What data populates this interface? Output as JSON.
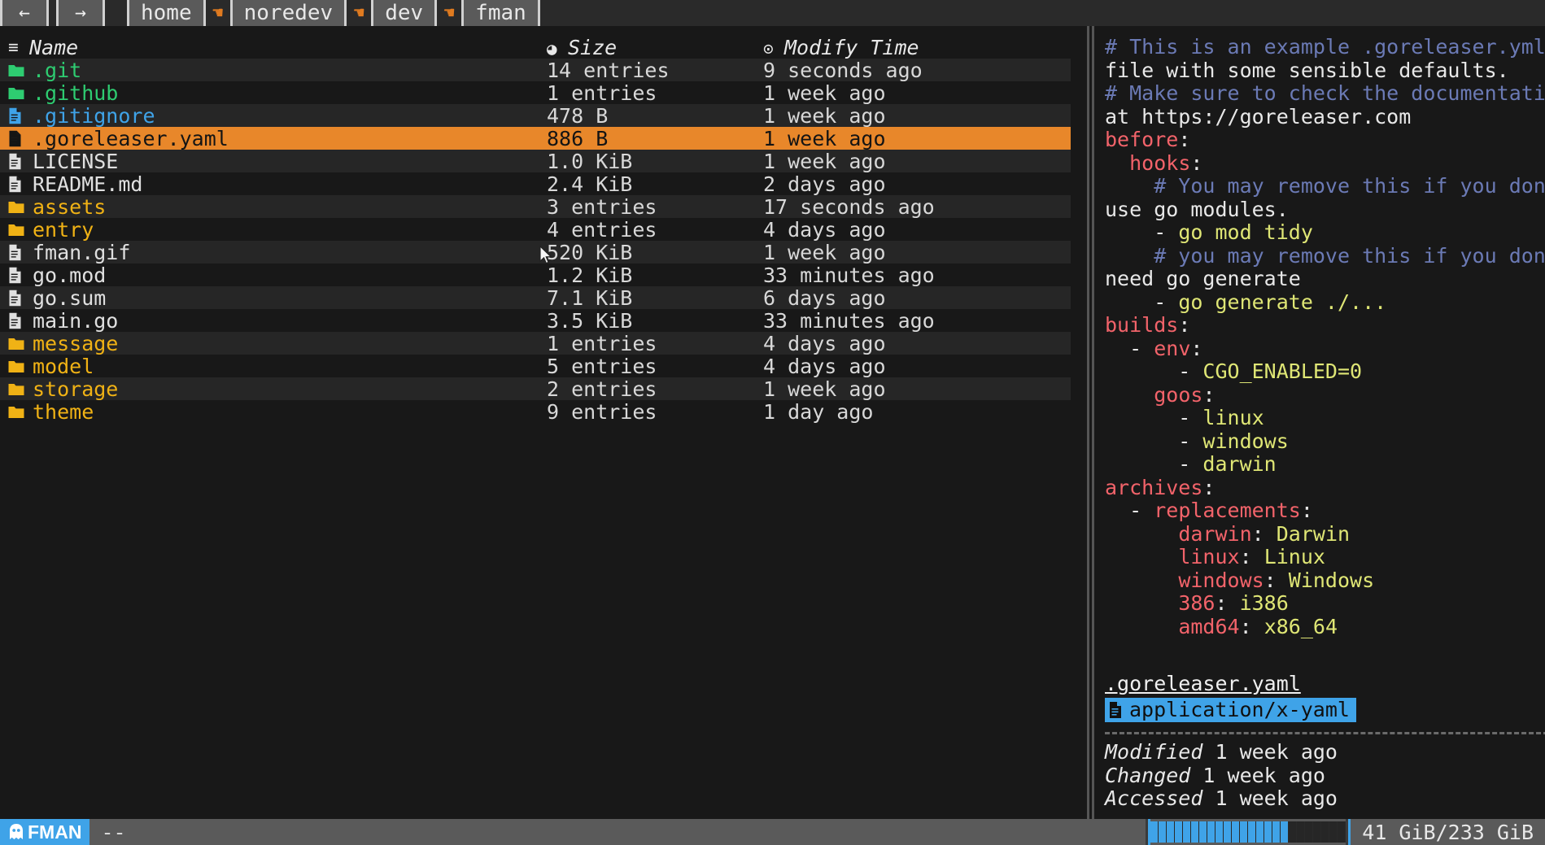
{
  "navbar": {
    "back_label": "←",
    "forward_label": "→",
    "separator_icon": "☚",
    "crumbs": [
      "home",
      "noredev",
      "dev",
      "fman"
    ]
  },
  "filelist": {
    "headers": {
      "name": "Name",
      "size": "Size",
      "time": "Modify Time",
      "name_icon": "≡",
      "size_icon": "◕",
      "time_icon": "⊙"
    },
    "rows": [
      {
        "name": ".git",
        "type": "folder",
        "color": "green",
        "size": "14 entries",
        "time": "9 seconds ago",
        "selected": false
      },
      {
        "name": ".github",
        "type": "folder",
        "color": "green",
        "size": "1 entries",
        "time": "1 week ago",
        "selected": false
      },
      {
        "name": ".gitignore",
        "type": "file",
        "color": "blue",
        "size": "478 B",
        "time": "1 week ago",
        "selected": false
      },
      {
        "name": ".goreleaser.yaml",
        "type": "file",
        "color": "dark",
        "size": "886 B",
        "time": "1 week ago",
        "selected": true
      },
      {
        "name": "LICENSE",
        "type": "file",
        "color": "white",
        "size": "1.0 KiB",
        "time": "1 week ago",
        "selected": false
      },
      {
        "name": "README.md",
        "type": "file",
        "color": "white",
        "size": "2.4 KiB",
        "time": "2 days ago",
        "selected": false
      },
      {
        "name": "assets",
        "type": "folder",
        "color": "yellow",
        "size": "3 entries",
        "time": "17 seconds ago",
        "selected": false
      },
      {
        "name": "entry",
        "type": "folder",
        "color": "yellow",
        "size": "4 entries",
        "time": "4 days ago",
        "selected": false
      },
      {
        "name": "fman.gif",
        "type": "file",
        "color": "white",
        "size": "520 KiB",
        "time": "1 week ago",
        "selected": false
      },
      {
        "name": "go.mod",
        "type": "file",
        "color": "white",
        "size": "1.2 KiB",
        "time": "33 minutes ago",
        "selected": false
      },
      {
        "name": "go.sum",
        "type": "file",
        "color": "white",
        "size": "7.1 KiB",
        "time": "6 days ago",
        "selected": false
      },
      {
        "name": "main.go",
        "type": "file",
        "color": "white",
        "size": "3.5 KiB",
        "time": "33 minutes ago",
        "selected": false
      },
      {
        "name": "message",
        "type": "folder",
        "color": "yellow",
        "size": "1 entries",
        "time": "4 days ago",
        "selected": false
      },
      {
        "name": "model",
        "type": "folder",
        "color": "yellow",
        "size": "5 entries",
        "time": "4 days ago",
        "selected": false
      },
      {
        "name": "storage",
        "type": "folder",
        "color": "yellow",
        "size": "2 entries",
        "time": "1 week ago",
        "selected": false
      },
      {
        "name": "theme",
        "type": "folder",
        "color": "yellow",
        "size": "9 entries",
        "time": "1 day ago",
        "selected": false
      }
    ]
  },
  "preview": {
    "lines": [
      [
        {
          "t": "# This is an example .goreleaser.yml",
          "c": "com"
        }
      ],
      [
        {
          "t": "file with some sensible defaults.",
          "c": "txt"
        }
      ],
      [
        {
          "t": "# Make sure to check the documentation",
          "c": "com"
        }
      ],
      [
        {
          "t": "at https://goreleaser.com",
          "c": "txt"
        }
      ],
      [
        {
          "t": "before",
          "c": "key"
        },
        {
          "t": ":",
          "c": "txt"
        }
      ],
      [
        {
          "t": "  ",
          "c": "txt"
        },
        {
          "t": "hooks",
          "c": "key"
        },
        {
          "t": ":",
          "c": "txt"
        }
      ],
      [
        {
          "t": "    # You may remove this if you don't",
          "c": "com"
        }
      ],
      [
        {
          "t": "use go modules.",
          "c": "txt"
        }
      ],
      [
        {
          "t": "    - ",
          "c": "txt"
        },
        {
          "t": "go mod tidy",
          "c": "val"
        }
      ],
      [
        {
          "t": "    # you may remove this if you don't",
          "c": "com"
        }
      ],
      [
        {
          "t": "need go generate",
          "c": "txt"
        }
      ],
      [
        {
          "t": "    - ",
          "c": "txt"
        },
        {
          "t": "go generate ./...",
          "c": "val"
        }
      ],
      [
        {
          "t": "builds",
          "c": "key"
        },
        {
          "t": ":",
          "c": "txt"
        }
      ],
      [
        {
          "t": "  - ",
          "c": "txt"
        },
        {
          "t": "env",
          "c": "key"
        },
        {
          "t": ":",
          "c": "txt"
        }
      ],
      [
        {
          "t": "      - ",
          "c": "txt"
        },
        {
          "t": "CGO_ENABLED=0",
          "c": "val"
        }
      ],
      [
        {
          "t": "    ",
          "c": "txt"
        },
        {
          "t": "goos",
          "c": "key"
        },
        {
          "t": ":",
          "c": "txt"
        }
      ],
      [
        {
          "t": "      - ",
          "c": "txt"
        },
        {
          "t": "linux",
          "c": "val"
        }
      ],
      [
        {
          "t": "      - ",
          "c": "txt"
        },
        {
          "t": "windows",
          "c": "val"
        }
      ],
      [
        {
          "t": "      - ",
          "c": "txt"
        },
        {
          "t": "darwin",
          "c": "val"
        }
      ],
      [
        {
          "t": "archives",
          "c": "key"
        },
        {
          "t": ":",
          "c": "txt"
        }
      ],
      [
        {
          "t": "  - ",
          "c": "txt"
        },
        {
          "t": "replacements",
          "c": "key"
        },
        {
          "t": ":",
          "c": "txt"
        }
      ],
      [
        {
          "t": "      ",
          "c": "txt"
        },
        {
          "t": "darwin",
          "c": "key"
        },
        {
          "t": ": ",
          "c": "txt"
        },
        {
          "t": "Darwin",
          "c": "val"
        }
      ],
      [
        {
          "t": "      ",
          "c": "txt"
        },
        {
          "t": "linux",
          "c": "key"
        },
        {
          "t": ": ",
          "c": "txt"
        },
        {
          "t": "Linux",
          "c": "val"
        }
      ],
      [
        {
          "t": "      ",
          "c": "txt"
        },
        {
          "t": "windows",
          "c": "key"
        },
        {
          "t": ": ",
          "c": "txt"
        },
        {
          "t": "Windows",
          "c": "val"
        }
      ],
      [
        {
          "t": "      ",
          "c": "txt"
        },
        {
          "t": "386",
          "c": "key"
        },
        {
          "t": ": ",
          "c": "txt"
        },
        {
          "t": "i386",
          "c": "val"
        }
      ],
      [
        {
          "t": "      ",
          "c": "txt"
        },
        {
          "t": "amd64",
          "c": "key"
        },
        {
          "t": ": ",
          "c": "txt"
        },
        {
          "t": "x86_64",
          "c": "val"
        }
      ]
    ]
  },
  "fileinfo": {
    "filename": ".goreleaser.yaml",
    "mimetype": "application/x-yaml",
    "attributes": [
      {
        "label": "Modified",
        "value": "1 week ago"
      },
      {
        "label": "Changed",
        "value": "1 week ago"
      },
      {
        "label": "Accessed",
        "value": "1 week ago"
      }
    ]
  },
  "statusbar": {
    "app_name": "FMAN",
    "app_icon": "ghost-icon",
    "mode": "--",
    "disk_usage": "41 GiB/233 GiB",
    "gauge_total_cells": 24,
    "gauge_filled_cells": 17
  },
  "colors": {
    "accent_orange": "#e8872a",
    "accent_blue": "#3fa3e8",
    "folder_green": "#2ecc71",
    "folder_yellow": "#f0b215",
    "yaml_key_red": "#f2636a",
    "yaml_value": "#dfe675",
    "yaml_comment": "#6b7ab5"
  }
}
